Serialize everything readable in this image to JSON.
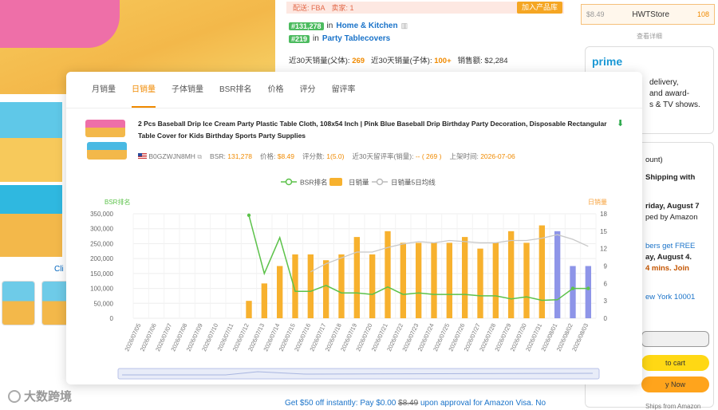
{
  "bg": {
    "click_hint": "Cli",
    "watermark": "大数跨境",
    "fba": {
      "tag": "配送: FBA",
      "sellers": "卖家: 1",
      "add_btn": "加入产品库"
    },
    "ranks": [
      {
        "rank": "#131,278",
        "in": "in",
        "cat": "Home & Kitchen"
      },
      {
        "rank": "#219",
        "in": "in",
        "cat": "Party Tablecovers"
      }
    ],
    "sales": {
      "l1": "近30天销量(父体):",
      "v1": "269",
      "l2": "近30天销量(子体):",
      "v2": "100+",
      "l3": "销售额:",
      "v3": "$2,284"
    },
    "seller": {
      "price": "$8.49",
      "name": "HWTStore",
      "count": "108"
    },
    "more": "查看详细",
    "prime": {
      "logo": "prime",
      "lines": [
        "delivery,",
        "and award-",
        "s & TV shows."
      ]
    },
    "buybox": {
      "lines": [
        "ount)",
        "Shipping with",
        "riday, August 7",
        "ped by Amazon",
        "bers get FREE",
        "ay, August 4.",
        "4 mins. Join",
        "ew York 10001"
      ],
      "cart": "to cart",
      "buy": "y Now",
      "ships": "Ships from    Amazon"
    },
    "promo": {
      "text": "Get $50 off instantly: Pay $0.00 ",
      "strike": "$8.49",
      "tail": " upon approval for Amazon Visa. No"
    }
  },
  "popup": {
    "tabs": [
      "月销量",
      "日销量",
      "子体销量",
      "BSR排名",
      "价格",
      "评分",
      "留评率"
    ],
    "active_tab": 1,
    "title": "2 Pcs Baseball Drip Ice Cream Party Plastic Table Cloth, 108x54 Inch | Pink Blue Baseball Drip Birthday Party Decoration, Disposable Rectangular Table Cover for Kids Birthday Sports Party Supplies",
    "asin": "B0GZWJN8MH",
    "bsr_label": "BSR:",
    "bsr": "131,278",
    "price_label": "价格:",
    "price": "$8.49",
    "rating_label": "评分数:",
    "rating": "1(5.0)",
    "review_label": "近30天留评率(销量):",
    "review": "-- ( 269 )",
    "listed_label": "上架时间:",
    "listed": "2026-07-06"
  },
  "chart_data": {
    "type": "bar",
    "legend": [
      "BSR排名",
      "日销量",
      "日销量5日均线"
    ],
    "left_axis_title": "BSR排名",
    "right_axis_title": "日销量",
    "left_ticks": [
      "350,000",
      "300,000",
      "250,000",
      "200,000",
      "150,000",
      "100,000",
      "50,000",
      "0"
    ],
    "right_ticks": [
      "18",
      "15",
      "12",
      "9",
      "6",
      "3",
      "0"
    ],
    "ylim_left": [
      0,
      350000
    ],
    "ylim_right": [
      0,
      18
    ],
    "categories": [
      "2026/07/05",
      "2026/07/06",
      "2026/07/07",
      "2026/07/08",
      "2026/07/09",
      "2026/07/10",
      "2026/07/11",
      "2026/07/12",
      "2026/07/13",
      "2026/07/14",
      "2026/07/15",
      "2026/07/16",
      "2026/07/17",
      "2026/07/18",
      "2026/07/19",
      "2026/07/20",
      "2026/07/21",
      "2026/07/22",
      "2026/07/23",
      "2026/07/24",
      "2026/07/25",
      "2026/07/26",
      "2026/07/27",
      "2026/07/28",
      "2026/07/29",
      "2026/07/30",
      "2026/07/31",
      "2026/08/01",
      "2026/08/02",
      "2026/08/03"
    ],
    "daily_sales": [
      null,
      null,
      null,
      null,
      null,
      null,
      null,
      3,
      6,
      9,
      11,
      11,
      10,
      11,
      14,
      11,
      15,
      13,
      13,
      13,
      13,
      14,
      12,
      13,
      15,
      13,
      16,
      15,
      9,
      9
    ],
    "forecast_from_index": 27,
    "ma5": [
      null,
      null,
      null,
      null,
      null,
      null,
      null,
      null,
      null,
      null,
      null,
      8,
      9.4,
      10.4,
      11.4,
      11.4,
      12.2,
      12.8,
      13.2,
      13,
      13.4,
      13.2,
      13,
      13,
      13.4,
      13.4,
      13.8,
      14.4,
      13.6,
      12.4
    ],
    "bsr": [
      null,
      null,
      null,
      null,
      null,
      null,
      null,
      345000,
      150000,
      270000,
      90000,
      90000,
      110000,
      85000,
      85000,
      80000,
      105000,
      80000,
      85000,
      80000,
      80000,
      80000,
      75000,
      75000,
      65000,
      72000,
      60000,
      62000,
      100000,
      100000
    ]
  }
}
